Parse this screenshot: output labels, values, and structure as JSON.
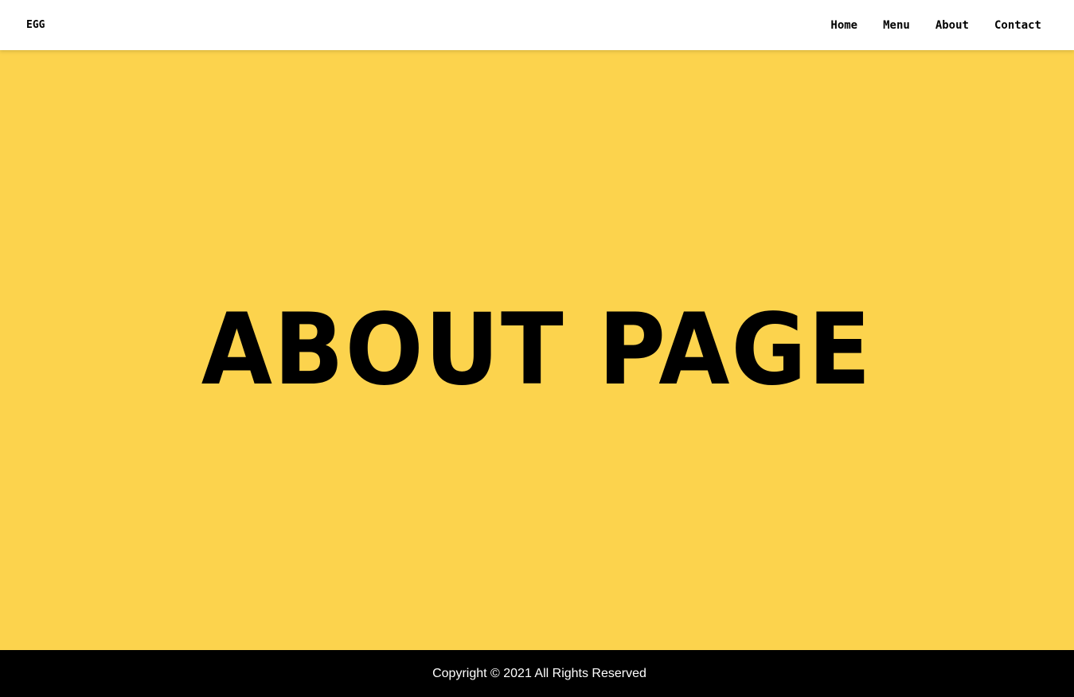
{
  "navbar": {
    "logo": "EGG",
    "links": [
      "Home",
      "Menu",
      "About",
      "Contact"
    ]
  },
  "hero": {
    "title": "ABOUT PAGE"
  },
  "footer": {
    "copyright": "Copyright © 2021 All Rights Reserved"
  },
  "colors": {
    "accent": "#fcd34d",
    "navbar_bg": "#ffffff",
    "footer_bg": "#000000",
    "text": "#000000"
  }
}
